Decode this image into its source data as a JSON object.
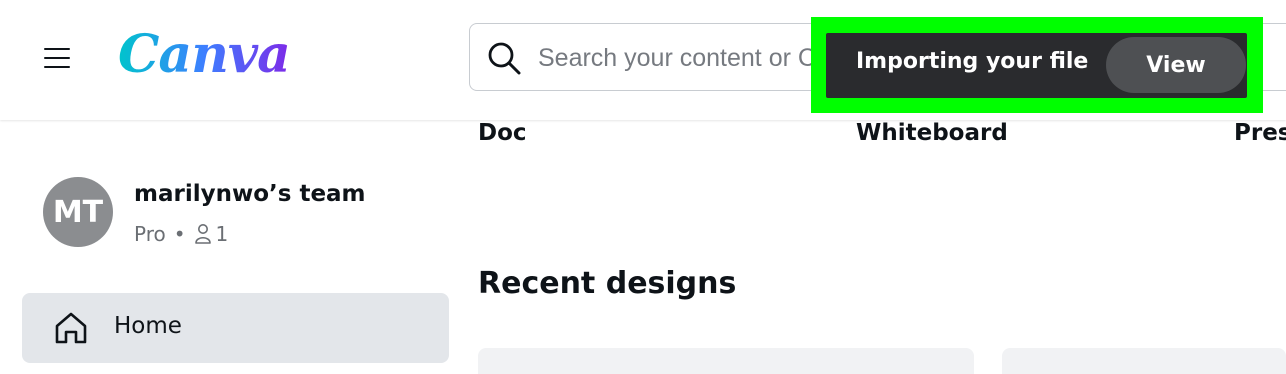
{
  "header": {
    "logo_text": "Canva",
    "search": {
      "placeholder": "Search your content or Canva's"
    }
  },
  "toast": {
    "message": "Importing your file",
    "action_label": "View",
    "highlight_color": "#00ff00"
  },
  "design_types": [
    {
      "label": "Doc"
    },
    {
      "label": "Whiteboard"
    },
    {
      "label": "Pres"
    }
  ],
  "sidebar": {
    "team": {
      "initials": "MT",
      "name": "marilynwo’s team",
      "plan": "Pro",
      "separator": "•",
      "members": "1"
    },
    "nav": [
      {
        "label": "Home",
        "icon": "home-icon",
        "selected": true
      }
    ]
  },
  "main": {
    "recent_title": "Recent designs"
  },
  "colors": {
    "brand_gradient": [
      "#00c4cc",
      "#3d7fff",
      "#7d2ae8"
    ],
    "toast_bg": "#2a2b2e",
    "nav_selected_bg": "#e3e6ea"
  }
}
